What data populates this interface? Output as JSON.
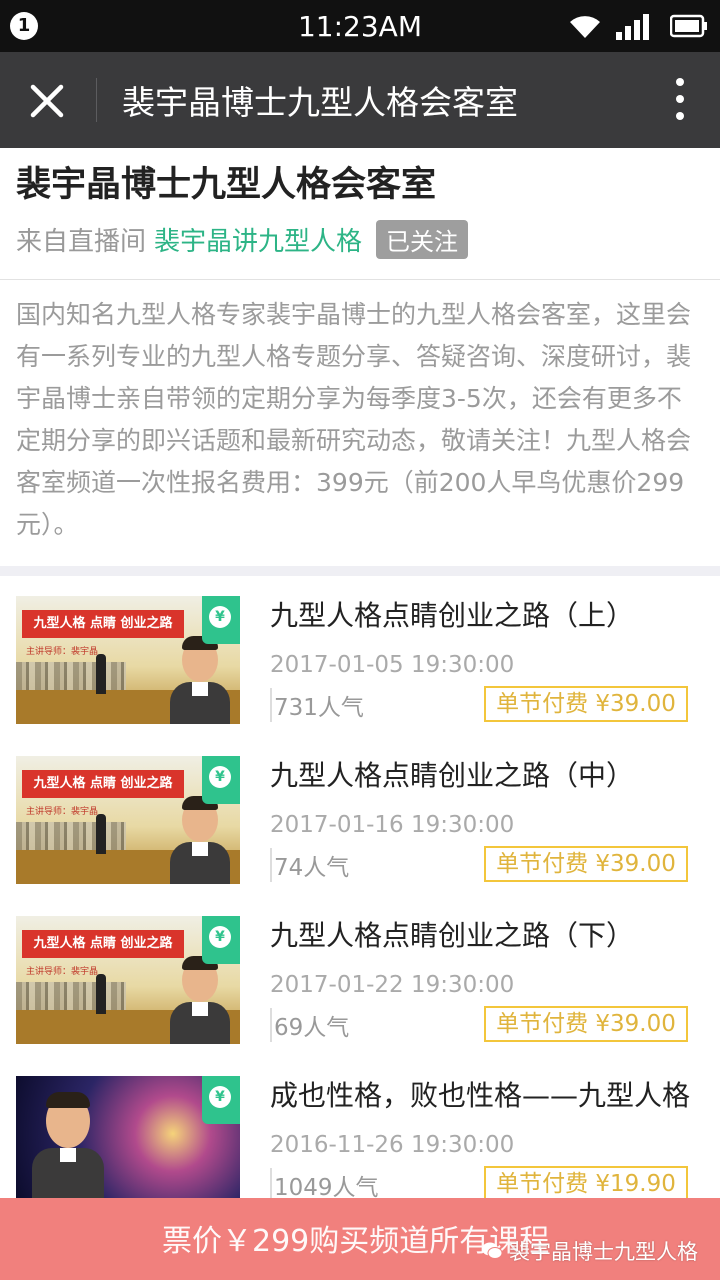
{
  "status_bar": {
    "notification_count": "1",
    "time": "11:23AM"
  },
  "nav": {
    "title": "裴宇晶博士九型人格会客室",
    "close_icon": "close-icon",
    "more_icon": "more-vertical-icon"
  },
  "header": {
    "title": "裴宇晶博士九型人格会客室",
    "source_prefix": "来自直播间",
    "source_name": "裴宇晶讲九型人格",
    "follow_status": "已关注"
  },
  "description": "国内知名九型人格专家裴宇晶博士的九型人格会客室，这里会有一系列专业的九型人格专题分享、答疑咨询、深度研讨，裴宇晶博士亲自带领的定期分享为每季度3-5次，还会有更多不定期分享的即兴话题和最新研究动态，敬请关注！九型人格会客室频道一次性报名费用：399元（前200人早鸟优惠价299元）。",
  "courses": [
    {
      "title": "九型人格点睛创业之路（上）",
      "date": "2017-01-05 19:30:00",
      "popularity": "731人气",
      "price": "单节付费 ¥39.00",
      "thumb_banner": "九型人格 点睛 创业之路",
      "thumb_sub": "主讲导师：裴宇晶"
    },
    {
      "title": "九型人格点睛创业之路（中）",
      "date": "2017-01-16 19:30:00",
      "popularity": "74人气",
      "price": "单节付费 ¥39.00",
      "thumb_banner": "九型人格 点睛 创业之路",
      "thumb_sub": "主讲导师：裴宇晶"
    },
    {
      "title": "九型人格点睛创业之路（下）",
      "date": "2017-01-22 19:30:00",
      "popularity": "69人气",
      "price": "单节付费 ¥39.00",
      "thumb_banner": "九型人格 点睛 创业之路",
      "thumb_sub": "主讲导师：裴宇晶"
    },
    {
      "title": "成也性格，败也性格——九型人格",
      "date": "2016-11-26 19:30:00",
      "popularity": "1049人气",
      "price": "单节付费 ¥19.90"
    }
  ],
  "buy_bar": {
    "label": "票价￥299购买频道所有课程",
    "watermark": "裴宇晶博士九型人格"
  },
  "colors": {
    "nav_bg": "#3a3a3c",
    "accent_green": "#2db486",
    "price_gold": "#f3c63b",
    "buy_bar_bg": "#f1807d"
  }
}
